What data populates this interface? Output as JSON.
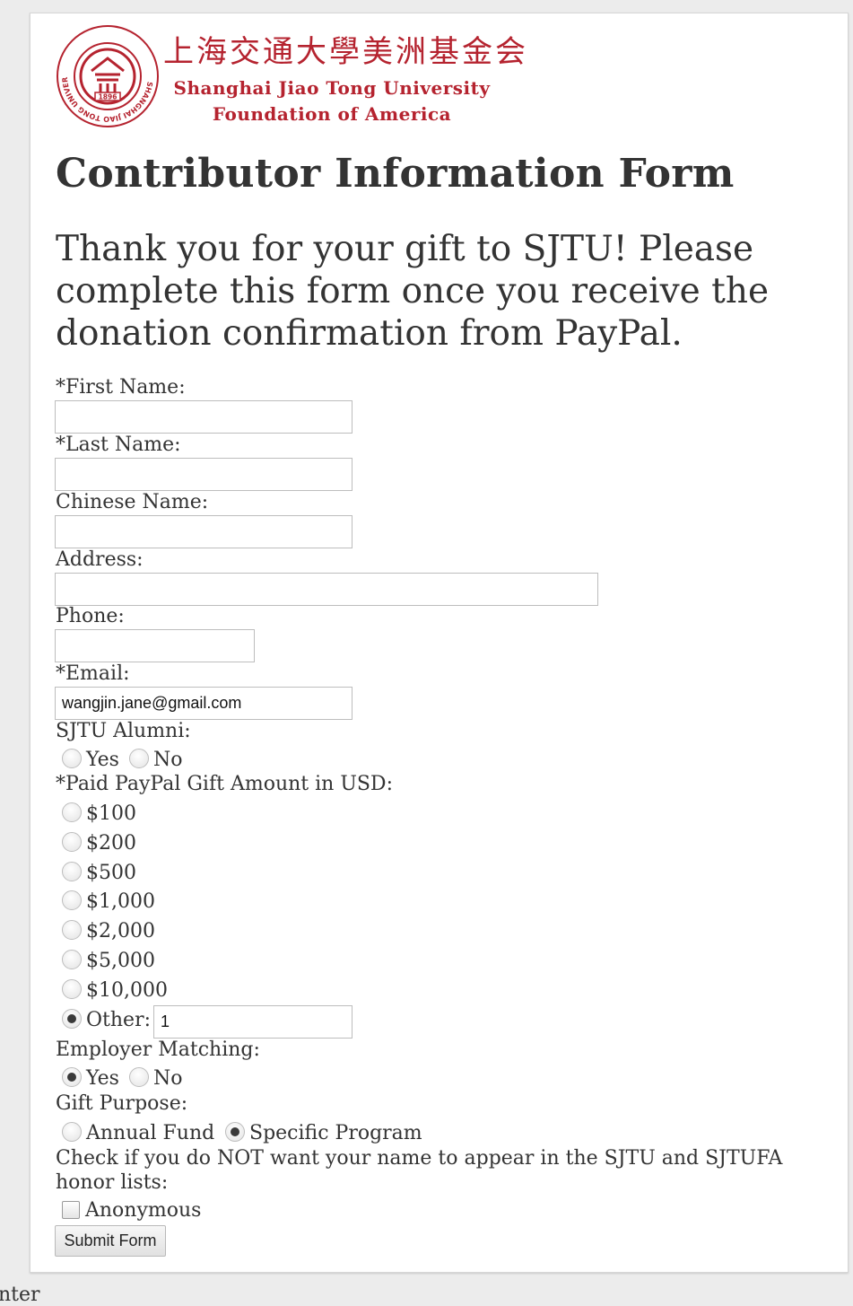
{
  "header": {
    "chinese_name": "上海交通大學美洲基金会",
    "english_name_line1": "Shanghai Jiao Tong University",
    "english_name_line2": "Foundation of America",
    "seal_text": "SHANGHAI JIAO TONG UNIVERSITY",
    "seal_year": "1896"
  },
  "title": "Contributor Information Form",
  "intro": "Thank you for your gift to SJTU! Please complete this form once you receive the donation confirmation from PayPal.",
  "fields": {
    "first_name": {
      "label": "*First Name:",
      "value": ""
    },
    "last_name": {
      "label": "*Last Name:",
      "value": ""
    },
    "chinese_name": {
      "label": "Chinese Name:",
      "value": ""
    },
    "address": {
      "label": "Address:",
      "value": ""
    },
    "phone": {
      "label": "Phone:",
      "value": ""
    },
    "email": {
      "label": "*Email:",
      "value": "wangjin.jane@gmail.com"
    }
  },
  "alumni": {
    "label": "SJTU Alumni:",
    "options": [
      "Yes",
      "No"
    ],
    "selected": null
  },
  "gift_amount": {
    "label": "*Paid PayPal Gift Amount in USD:",
    "options": [
      "$100",
      "$200",
      "$500",
      "$1,000",
      "$2,000",
      "$5,000",
      "$10,000",
      "Other:"
    ],
    "selected": "Other:",
    "other_value": "1"
  },
  "employer_matching": {
    "label": "Employer Matching:",
    "options": [
      "Yes",
      "No"
    ],
    "selected": "Yes"
  },
  "gift_purpose": {
    "label": "Gift Purpose:",
    "options": [
      "Annual Fund",
      "Specific Program"
    ],
    "selected": "Specific Program"
  },
  "honor_list": {
    "note": "Check if you do NOT want your name to appear in the SJTU and SJTUFA honor lists:",
    "checkbox_label": "Anonymous",
    "checked": false
  },
  "submit_label": "Submit Form",
  "footer_text": "nter",
  "colors": {
    "brand_red": "#b5232f",
    "text": "#333333",
    "page_bg": "#ececec"
  }
}
